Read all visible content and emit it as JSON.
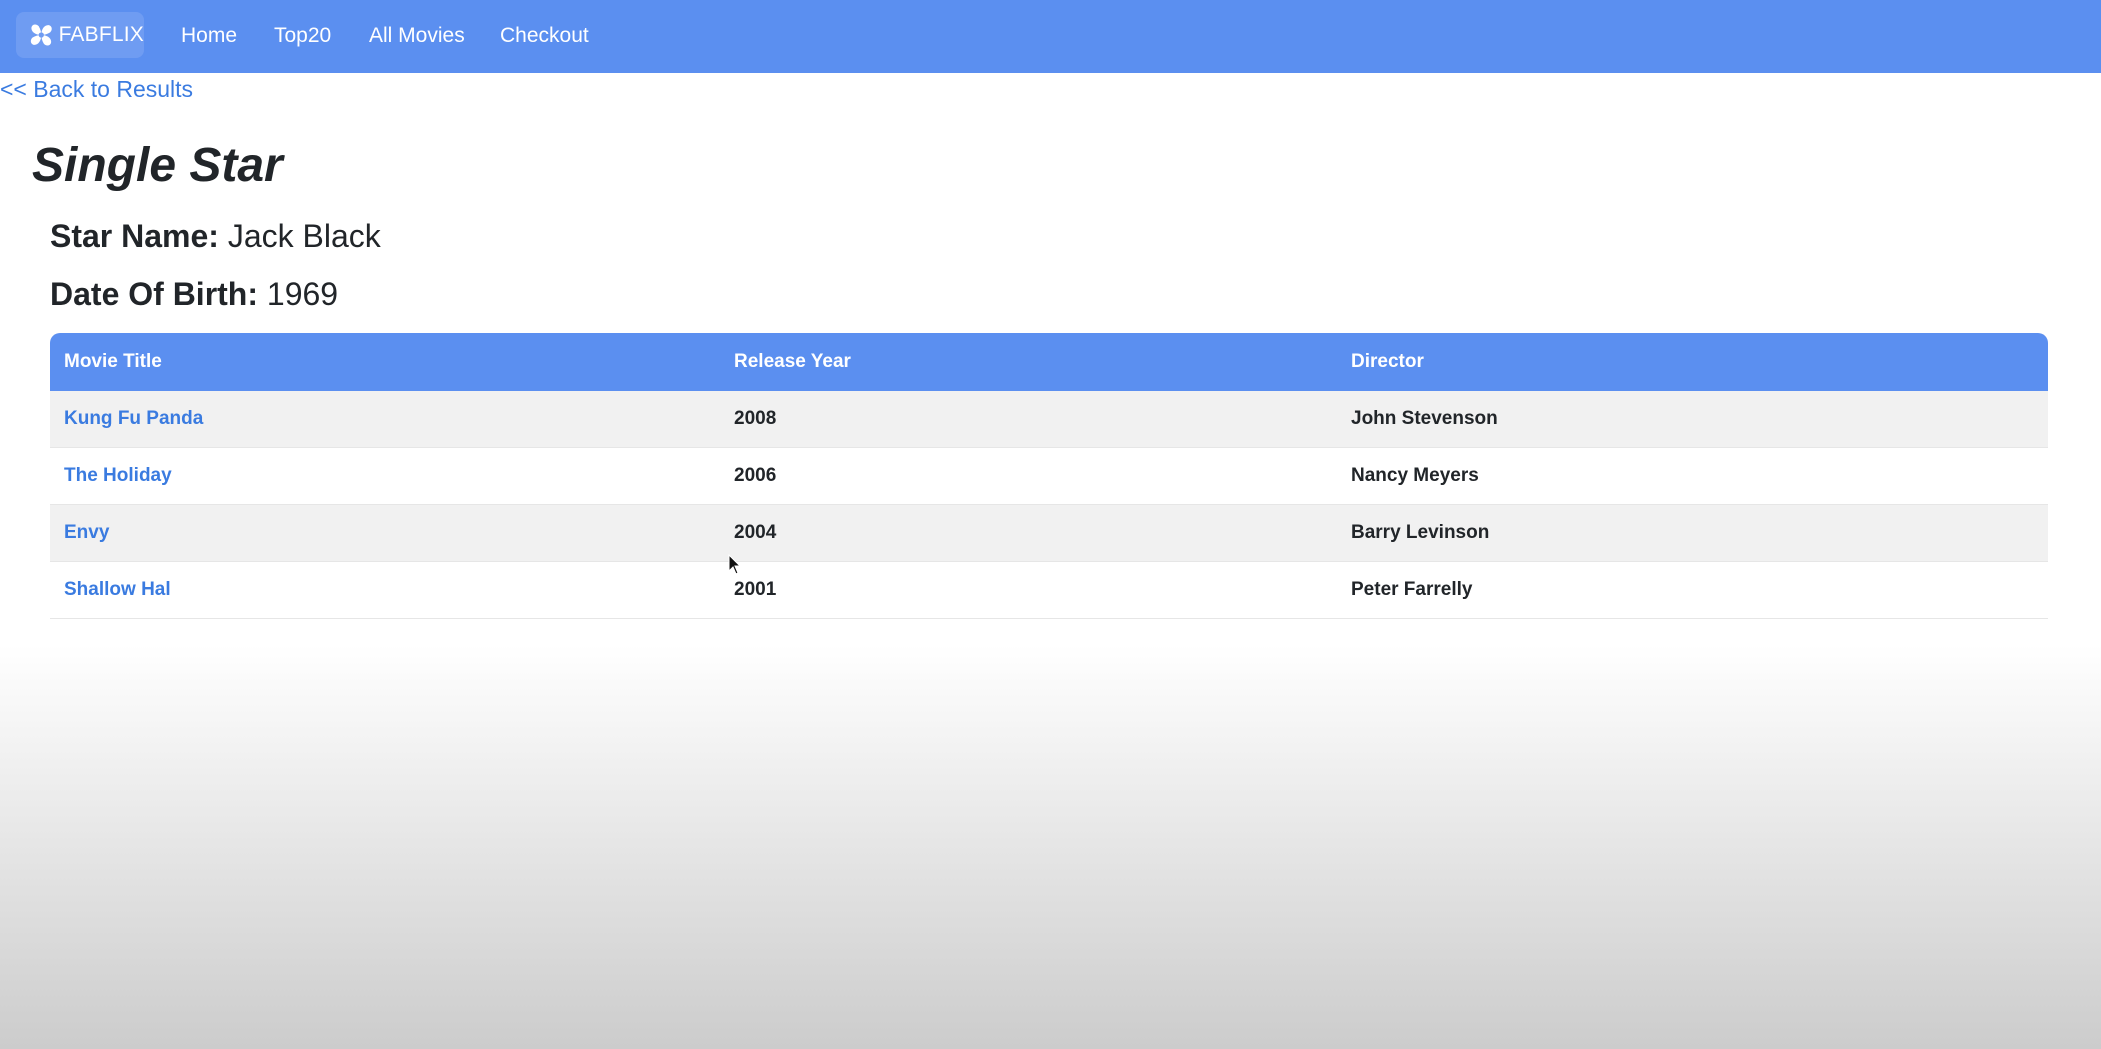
{
  "navbar": {
    "brand": "FABFLIX",
    "brand_icon": "fan-logo-icon",
    "links": [
      "Home",
      "Top20",
      "All Movies",
      "Checkout"
    ]
  },
  "back_link": "<< Back to Results",
  "page_title": "Single Star",
  "star": {
    "name_label": "Star Name:",
    "name": "Jack Black",
    "dob_label": "Date Of Birth:",
    "dob": "1969"
  },
  "table": {
    "headers": [
      "Movie Title",
      "Release Year",
      "Director"
    ],
    "rows": [
      {
        "title": "Kung Fu Panda",
        "year": "2008",
        "director": "John Stevenson"
      },
      {
        "title": "The Holiday",
        "year": "2006",
        "director": "Nancy Meyers"
      },
      {
        "title": "Envy",
        "year": "2004",
        "director": "Barry Levinson"
      },
      {
        "title": "Shallow Hal",
        "year": "2001",
        "director": "Peter Farrelly"
      }
    ]
  },
  "colors": {
    "navbar": "#5b8ff0",
    "link": "#3a7be0"
  }
}
